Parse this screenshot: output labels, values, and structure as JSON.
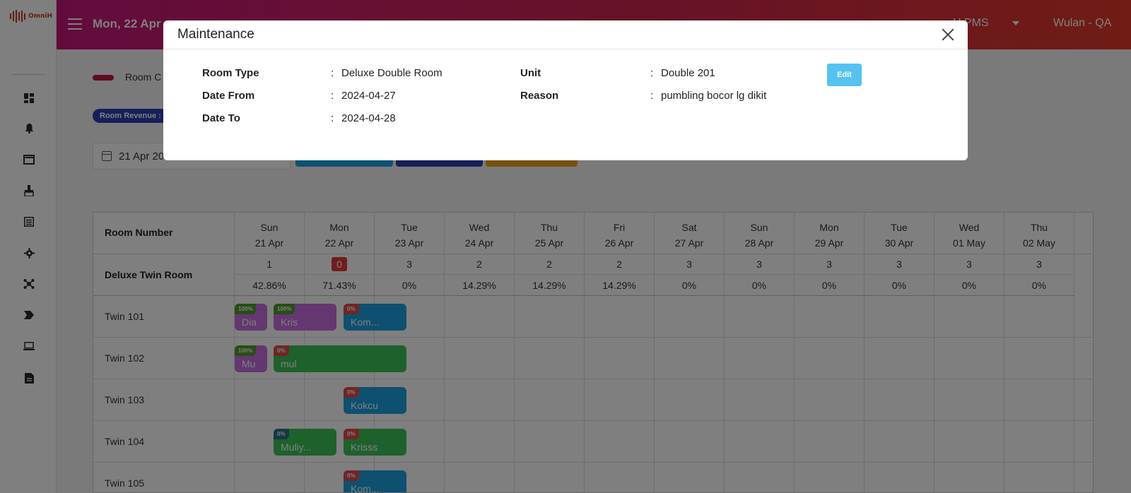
{
  "app": {
    "logo_text": "OmniH",
    "current_date": "Mon, 22 Apr",
    "property_menu": "H PMS",
    "user_menu": "Wulan - QA"
  },
  "sidebar": {
    "icons": [
      "dashboard-icon",
      "bell-icon",
      "folder-icon",
      "cleaning-icon",
      "list-icon",
      "gear-icon",
      "network-icon",
      "arrow-icon",
      "laptop-icon",
      "document-icon"
    ]
  },
  "page": {
    "legend_label": "Room C",
    "revenue_badge": "Room Revenue :",
    "date_range_value": "21 Apr 20"
  },
  "calendar": {
    "room_number_header": "Room Number",
    "days": [
      {
        "dow": "Sun",
        "date": "21 Apr",
        "count": "1",
        "occupancy": "42.86%"
      },
      {
        "dow": "Mon",
        "date": "22 Apr",
        "count": "0",
        "occupancy": "71.43%"
      },
      {
        "dow": "Tue",
        "date": "23 Apr",
        "count": "3",
        "occupancy": "0%"
      },
      {
        "dow": "Wed",
        "date": "24 Apr",
        "count": "2",
        "occupancy": "14.29%"
      },
      {
        "dow": "Thu",
        "date": "25 Apr",
        "count": "2",
        "occupancy": "14.29%"
      },
      {
        "dow": "Fri",
        "date": "26 Apr",
        "count": "2",
        "occupancy": "14.29%"
      },
      {
        "dow": "Sat",
        "date": "27 Apr",
        "count": "3",
        "occupancy": "0%"
      },
      {
        "dow": "Sun",
        "date": "28 Apr",
        "count": "3",
        "occupancy": "0%"
      },
      {
        "dow": "Mon",
        "date": "29 Apr",
        "count": "3",
        "occupancy": "0%"
      },
      {
        "dow": "Tue",
        "date": "30 Apr",
        "count": "3",
        "occupancy": "0%"
      },
      {
        "dow": "Wed",
        "date": "01 May",
        "count": "3",
        "occupancy": "0%"
      },
      {
        "dow": "Thu",
        "date": "02 May",
        "count": "3",
        "occupancy": "0%"
      }
    ],
    "room_type": "Deluxe Twin Room",
    "rooms": [
      "Twin 101",
      "Twin 102",
      "Twin 103",
      "Twin 104",
      "Twin 105"
    ],
    "bookings": [
      {
        "room": "Twin 101",
        "badge": "100%",
        "name": "Dia",
        "color": "#c86fe0"
      },
      {
        "room": "Twin 101",
        "badge": "100%",
        "name": "Kris",
        "color": "#c86fe0"
      },
      {
        "room": "Twin 101",
        "badge": "0%",
        "name": "Kom...",
        "color": "#1aa0e0"
      },
      {
        "room": "Twin 102",
        "badge": "100%",
        "name": "Mu",
        "color": "#c86fe0"
      },
      {
        "room": "Twin 102",
        "badge": "0%",
        "name": "mul",
        "color": "#3cc35a"
      },
      {
        "room": "Twin 103",
        "badge": "0%",
        "name": "Kokcu",
        "color": "#1aa0e0"
      },
      {
        "room": "Twin 104",
        "badge": "0%",
        "name": "Muliy...",
        "color": "#3cc35a"
      },
      {
        "room": "Twin 104",
        "badge": "0%",
        "name": "Krisss",
        "color": "#3cc35a"
      },
      {
        "room": "Twin 105",
        "badge": "0%",
        "name": "Kom...",
        "color": "#1aa0e0"
      }
    ]
  },
  "modal": {
    "title": "Maintenance",
    "room_type_label": "Room Type",
    "room_type_value": "Deluxe Double Room",
    "date_from_label": "Date From",
    "date_from_value": "2024-04-27",
    "date_to_label": "Date To",
    "date_to_value": "2024-04-28",
    "unit_label": "Unit",
    "unit_value": "Double 201",
    "reason_label": "Reason",
    "reason_value": "pumbling bocor lg dikit",
    "colon": ":",
    "edit_label": "Edit"
  }
}
